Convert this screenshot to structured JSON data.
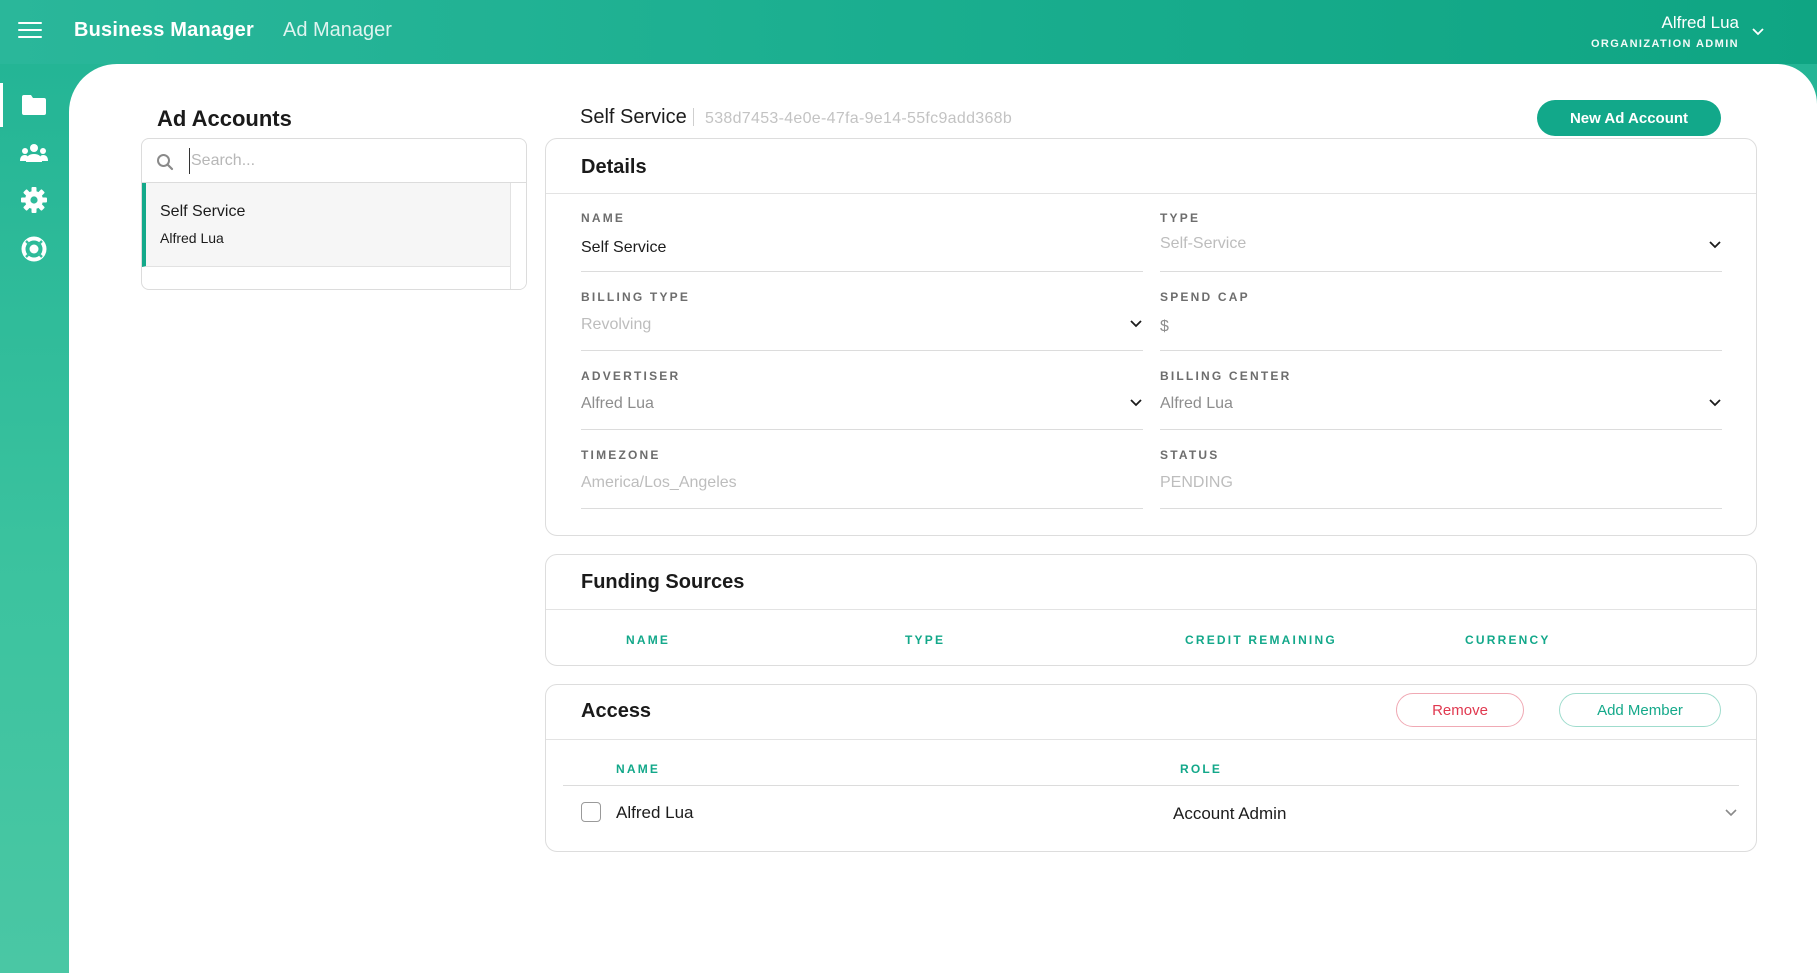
{
  "topbar": {
    "brand": "Business Manager",
    "nav_ad_manager": "Ad Manager",
    "user_name": "Alfred Lua",
    "user_role": "ORGANIZATION ADMIN"
  },
  "rail": {
    "items": [
      {
        "icon": "folder-icon",
        "active": true
      },
      {
        "icon": "users-icon",
        "active": false
      },
      {
        "icon": "gear-icon",
        "active": false
      },
      {
        "icon": "support-icon",
        "active": false
      }
    ]
  },
  "sidebar": {
    "title": "Ad Accounts",
    "search_placeholder": "Search...",
    "accounts": [
      {
        "name": "Self Service",
        "owner": "Alfred Lua"
      }
    ]
  },
  "header": {
    "account_name": "Self Service",
    "account_id": "538d7453-4e0e-47fa-9e14-55fc9add368b",
    "new_button": "New Ad Account"
  },
  "details": {
    "title": "Details",
    "name_label": "NAME",
    "name_value": "Self Service",
    "type_label": "TYPE",
    "type_value": "Self-Service",
    "billing_type_label": "BILLING TYPE",
    "billing_type_value": "Revolving",
    "spend_cap_label": "SPEND CAP",
    "spend_cap_value": "$",
    "advertiser_label": "ADVERTISER",
    "advertiser_value": "Alfred Lua",
    "billing_center_label": "BILLING CENTER",
    "billing_center_value": "Alfred Lua",
    "timezone_label": "TIMEZONE",
    "timezone_value": "America/Los_Angeles",
    "status_label": "STATUS",
    "status_value": "PENDING"
  },
  "funding": {
    "title": "Funding Sources",
    "columns": [
      "NAME",
      "TYPE",
      "CREDIT REMAINING",
      "CURRENCY"
    ]
  },
  "access": {
    "title": "Access",
    "remove_button": "Remove",
    "add_button": "Add Member",
    "columns": [
      "NAME",
      "ROLE"
    ],
    "rows": [
      {
        "name": "Alfred Lua",
        "role": "Account Admin"
      }
    ]
  },
  "colors": {
    "accent": "#12a88a",
    "remove": "#e0384f"
  }
}
